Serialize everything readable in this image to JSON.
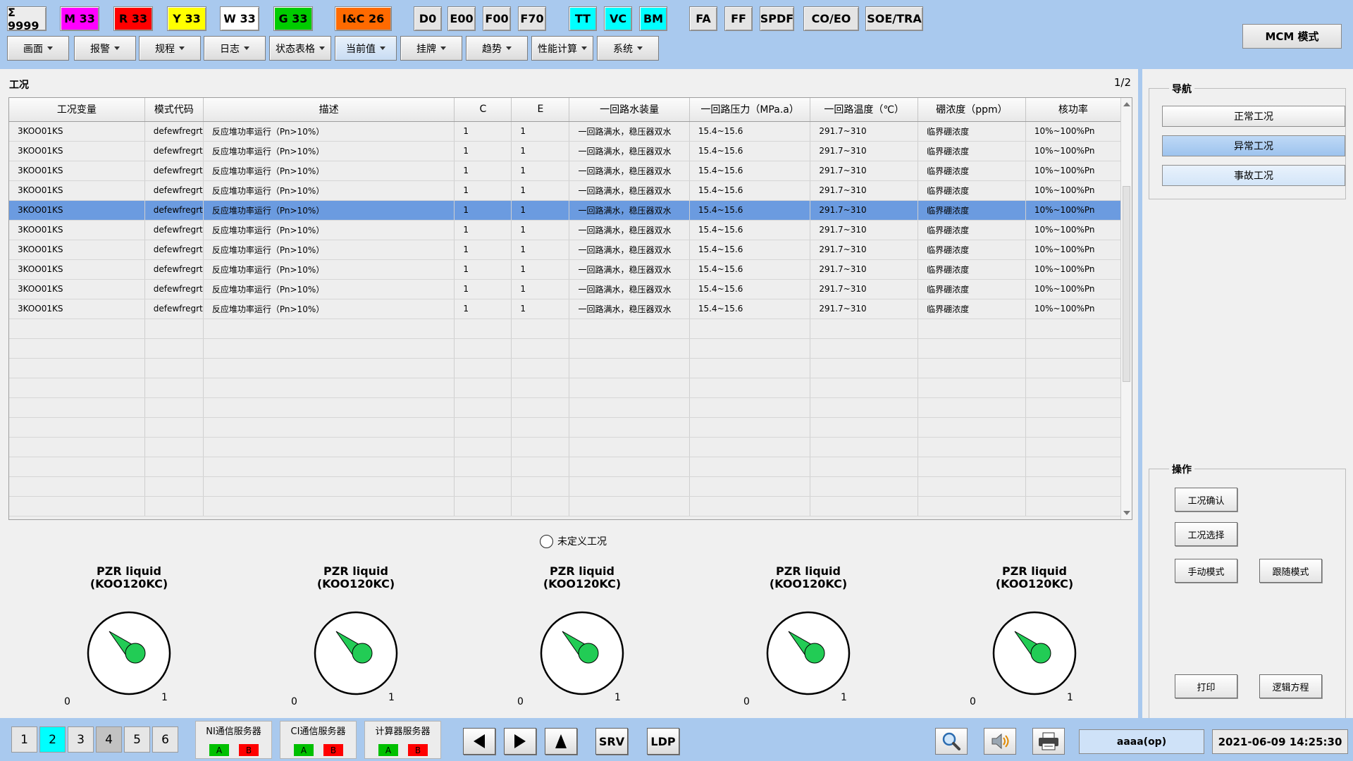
{
  "alarm_bar": [
    {
      "label": "Σ 9999",
      "color": "#ececec"
    },
    {
      "label": "M 33",
      "color": "#ff00ff"
    },
    {
      "label": "R 33",
      "color": "#ff0000"
    },
    {
      "label": "Y 33",
      "color": "#ffff00"
    },
    {
      "label": "W 33",
      "color": "#ffffff"
    },
    {
      "label": "G 33",
      "color": "#00cc00"
    },
    {
      "label": "I&C  26",
      "color": "#ff6a00"
    },
    {
      "label": "D0",
      "color": "#e4e4e4"
    },
    {
      "label": "E00",
      "color": "#e4e4e4"
    },
    {
      "label": "F00",
      "color": "#e4e4e4"
    },
    {
      "label": "F70",
      "color": "#e4e4e4"
    },
    {
      "label": "TT",
      "color": "#00ffff"
    },
    {
      "label": "VC",
      "color": "#00ffff"
    },
    {
      "label": "BM",
      "color": "#00ffff"
    },
    {
      "label": "FA",
      "color": "#e4e4e4"
    },
    {
      "label": "FF",
      "color": "#e4e4e4"
    },
    {
      "label": "SPDF",
      "color": "#e4e4e4"
    },
    {
      "label": "CO/EO",
      "color": "#e4e4e4"
    },
    {
      "label": "SOE/TRA",
      "color": "#e4e4e4"
    }
  ],
  "menu": [
    {
      "label": "画面"
    },
    {
      "label": "报警"
    },
    {
      "label": "规程"
    },
    {
      "label": "日志"
    },
    {
      "label": "状态表格"
    },
    {
      "label": "当前值"
    },
    {
      "label": "挂牌"
    },
    {
      "label": "趋势"
    },
    {
      "label": "性能计算"
    },
    {
      "label": "系统"
    }
  ],
  "mode_button": "MCM  模式",
  "main": {
    "title": "工况",
    "page_indicator": "1/2",
    "columns": [
      "工况变量",
      "模式代码",
      "描述",
      "C",
      "E",
      "一回路水装量",
      "一回路压力（MPa.a）",
      "一回路温度（℃）",
      "硼浓度（ppm）",
      "核功率"
    ],
    "rows": [
      [
        "3KOO01KS",
        "defewfregrths",
        "反应堆功率运行（Pn>10%）",
        "1",
        "1",
        "一回路满水，稳压器双水",
        "15.4~15.6",
        "291.7~310",
        "临界硼浓度",
        "10%~100%Pn"
      ],
      [
        "3KOO01KS",
        "defewfregrths",
        "反应堆功率运行（Pn>10%）",
        "1",
        "1",
        "一回路满水，稳压器双水",
        "15.4~15.6",
        "291.7~310",
        "临界硼浓度",
        "10%~100%Pn"
      ],
      [
        "3KOO01KS",
        "defewfregrths",
        "反应堆功率运行（Pn>10%）",
        "1",
        "1",
        "一回路满水，稳压器双水",
        "15.4~15.6",
        "291.7~310",
        "临界硼浓度",
        "10%~100%Pn"
      ],
      [
        "3KOO01KS",
        "defewfregrths",
        "反应堆功率运行（Pn>10%）",
        "1",
        "1",
        "一回路满水，稳压器双水",
        "15.4~15.6",
        "291.7~310",
        "临界硼浓度",
        "10%~100%Pn"
      ],
      [
        "3KOO01KS",
        "defewfregrths",
        "反应堆功率运行（Pn>10%）",
        "1",
        "1",
        "一回路满水，稳压器双水",
        "15.4~15.6",
        "291.7~310",
        "临界硼浓度",
        "10%~100%Pn"
      ],
      [
        "3KOO01KS",
        "defewfregrths",
        "反应堆功率运行（Pn>10%）",
        "1",
        "1",
        "一回路满水，稳压器双水",
        "15.4~15.6",
        "291.7~310",
        "临界硼浓度",
        "10%~100%Pn"
      ],
      [
        "3KOO01KS",
        "defewfregrths",
        "反应堆功率运行（Pn>10%）",
        "1",
        "1",
        "一回路满水，稳压器双水",
        "15.4~15.6",
        "291.7~310",
        "临界硼浓度",
        "10%~100%Pn"
      ],
      [
        "3KOO01KS",
        "defewfregrths",
        "反应堆功率运行（Pn>10%）",
        "1",
        "1",
        "一回路满水，稳压器双水",
        "15.4~15.6",
        "291.7~310",
        "临界硼浓度",
        "10%~100%Pn"
      ],
      [
        "3KOO01KS",
        "defewfregrths",
        "反应堆功率运行（Pn>10%）",
        "1",
        "1",
        "一回路满水，稳压器双水",
        "15.4~15.6",
        "291.7~310",
        "临界硼浓度",
        "10%~100%Pn"
      ],
      [
        "3KOO01KS",
        "defewfregrths",
        "反应堆功率运行（Pn>10%）",
        "1",
        "1",
        "一回路满水，稳压器双水",
        "15.4~15.6",
        "291.7~310",
        "临界硼浓度",
        "10%~100%Pn"
      ]
    ],
    "selected_row": 4,
    "undefined_label": "未定义工况",
    "gauges": [
      {
        "title": "PZR liquid",
        "tag": "(KOO120KC)",
        "min": "0",
        "max": "1"
      },
      {
        "title": "PZR liquid",
        "tag": "(KOO120KC)",
        "min": "0",
        "max": "1"
      },
      {
        "title": "PZR liquid",
        "tag": "(KOO120KC)",
        "min": "0",
        "max": "1"
      },
      {
        "title": "PZR liquid",
        "tag": "(KOO120KC)",
        "min": "0",
        "max": "1"
      },
      {
        "title": "PZR liquid",
        "tag": "(KOO120KC)",
        "min": "0",
        "max": "1"
      }
    ]
  },
  "nav": {
    "title": "导航",
    "buttons": [
      "正常工况",
      "异常工况",
      "事故工况"
    ]
  },
  "ops": {
    "title": "操作",
    "confirm": "工况确认",
    "select": "工况选择",
    "manual": "手动模式",
    "follow": "跟随模式",
    "print": "打印",
    "logic": "逻辑方程"
  },
  "bottom": {
    "pages": [
      "1",
      "2",
      "3",
      "4",
      "5",
      "6"
    ],
    "servers": [
      {
        "label": "NI通信服务器",
        "a": "A",
        "b": "B"
      },
      {
        "label": "CI通信服务器",
        "a": "A",
        "b": "B"
      },
      {
        "label": "计算器服务器",
        "a": "A",
        "b": "B"
      }
    ],
    "srv": "SRV",
    "ldp": "LDP",
    "user": "aaaa(op)",
    "datetime": "2021-06-09  14:25:30"
  }
}
